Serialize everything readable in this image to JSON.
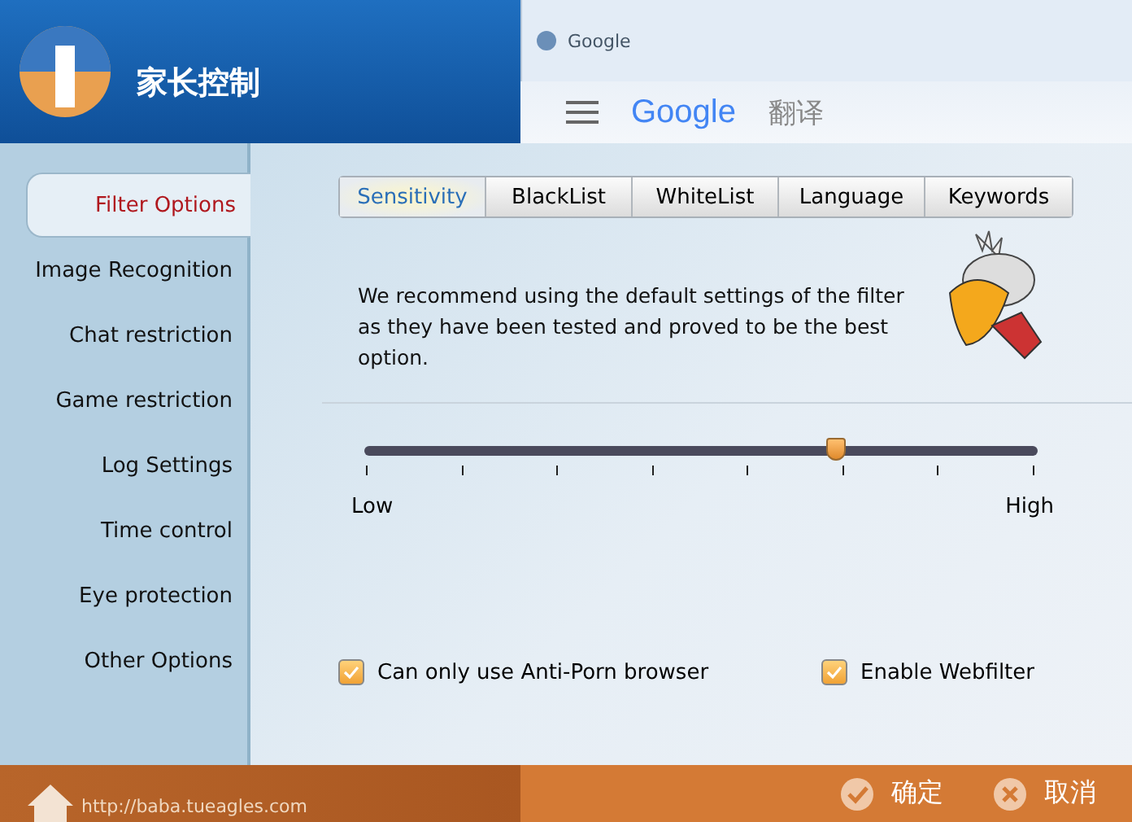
{
  "header": {
    "product": "家长控制",
    "background_window": {
      "tab_title": "Google",
      "logo": "Google",
      "page_title": "翻译"
    }
  },
  "sidebar": {
    "items": [
      {
        "label": "Filter Options",
        "selected": true
      },
      {
        "label": "Image Recognition",
        "selected": false
      },
      {
        "label": "Chat restriction",
        "selected": false
      },
      {
        "label": "Game restriction",
        "selected": false
      },
      {
        "label": "Log Settings",
        "selected": false
      },
      {
        "label": "Time control",
        "selected": false
      },
      {
        "label": "Eye protection",
        "selected": false
      },
      {
        "label": "Other Options",
        "selected": false
      }
    ]
  },
  "tabs": [
    {
      "label": "Sensitivity",
      "selected": true
    },
    {
      "label": "BlackList",
      "selected": false
    },
    {
      "label": "WhiteList",
      "selected": false
    },
    {
      "label": "Language",
      "selected": false
    },
    {
      "label": "Keywords",
      "selected": false
    }
  ],
  "description": "We recommend using the default settings of the filter as they have been tested and proved to be the best option.",
  "slider": {
    "level": 0.7,
    "min_label": "Low",
    "max_label": "High"
  },
  "options": [
    {
      "label": "Can only use Anti-Porn browser",
      "checked": true
    },
    {
      "label": "Enable Webfilter",
      "checked": true
    }
  ],
  "footer": {
    "url": "http://baba.tueagles.com",
    "ok": "确定",
    "cancel": "取消"
  }
}
